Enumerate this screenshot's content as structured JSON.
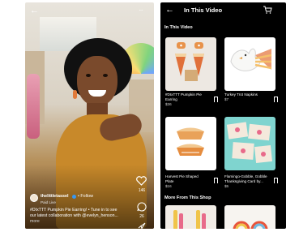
{
  "video": {
    "username": "thelittletassel",
    "follow": "• Follow",
    "subtitle": "Paid Live",
    "caption_line1": "#DIxTTT Pumpkin Pie Earring! • Tune in to see",
    "caption_line2": "our latest collaboration with @evelyn_henson...",
    "caption_more": "more",
    "like_count": "146",
    "comment_count": "26",
    "menu_glyph": "···",
    "back_glyph": "←"
  },
  "shop": {
    "title": "In This Video",
    "section_in_video": "In This Video",
    "section_more": "More From This Shop",
    "back_glyph": "←",
    "products": [
      {
        "name": "#DIxTTT Pumpkin Pie",
        "name2": "Earring",
        "price": "$36"
      },
      {
        "name": "Turkey Trot Napkins",
        "name2": "",
        "price": "$7"
      },
      {
        "name": "Harvest Pie Shaped",
        "name2": "Plate",
        "price": "$16"
      },
      {
        "name": "Flamingo-Gobble, Gobble",
        "name2": "Thanksgiving Card by...",
        "price": "$5"
      }
    ]
  },
  "colors": {
    "accent_orange": "#e07a3a",
    "verified_blue": "#3897f0"
  }
}
